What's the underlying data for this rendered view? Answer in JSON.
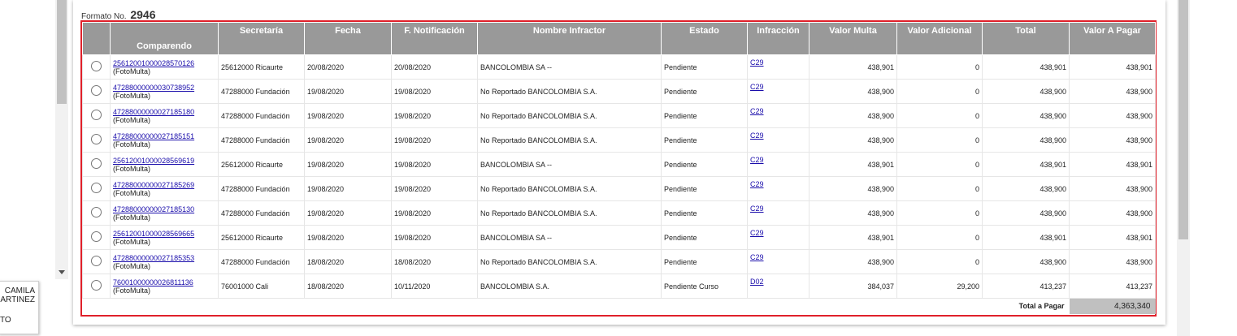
{
  "left_panel": {
    "line1": "CAMILA",
    "line2": "ARTINEZ",
    "line3": "TO"
  },
  "formato": {
    "label": "Formato No.",
    "number": "2946"
  },
  "headers": [
    "",
    "Comparendo",
    "Secretaría",
    "Fecha",
    "F. Notificación",
    "Nombre Infractor",
    "Estado",
    "Infracción",
    "Valor Multa",
    "Valor Adicional",
    "Total",
    "Valor A Pagar"
  ],
  "rows": [
    {
      "comparendo": "25612001000028570126",
      "tipo": "(FotoMulta)",
      "secretaria": "25612000 Ricaurte",
      "fecha": "20/08/2020",
      "notificacion": "20/08/2020",
      "infractor": "BANCOLOMBIA SA --",
      "estado": "Pendiente",
      "infraccion": "C29",
      "valor_multa": "438,901",
      "valor_adicional": "0",
      "total": "438,901",
      "valor_pagar": "438,901"
    },
    {
      "comparendo": "47288000000030738952",
      "tipo": "(FotoMulta)",
      "secretaria": "47288000 Fundación",
      "fecha": "19/08/2020",
      "notificacion": "19/08/2020",
      "infractor": "No Reportado BANCOLOMBIA S.A.",
      "estado": "Pendiente",
      "infraccion": "C29",
      "valor_multa": "438,900",
      "valor_adicional": "0",
      "total": "438,900",
      "valor_pagar": "438,900"
    },
    {
      "comparendo": "47288000000027185180",
      "tipo": "(FotoMulta)",
      "secretaria": "47288000 Fundación",
      "fecha": "19/08/2020",
      "notificacion": "19/08/2020",
      "infractor": "No Reportado BANCOLOMBIA S.A.",
      "estado": "Pendiente",
      "infraccion": "C29",
      "valor_multa": "438,900",
      "valor_adicional": "0",
      "total": "438,900",
      "valor_pagar": "438,900"
    },
    {
      "comparendo": "47288000000027185151",
      "tipo": "(FotoMulta)",
      "secretaria": "47288000 Fundación",
      "fecha": "19/08/2020",
      "notificacion": "19/08/2020",
      "infractor": "No Reportado BANCOLOMBIA S.A.",
      "estado": "Pendiente",
      "infraccion": "C29",
      "valor_multa": "438,900",
      "valor_adicional": "0",
      "total": "438,900",
      "valor_pagar": "438,900"
    },
    {
      "comparendo": "25612001000028569619",
      "tipo": "(FotoMulta)",
      "secretaria": "25612000 Ricaurte",
      "fecha": "19/08/2020",
      "notificacion": "19/08/2020",
      "infractor": "BANCOLOMBIA SA --",
      "estado": "Pendiente",
      "infraccion": "C29",
      "valor_multa": "438,901",
      "valor_adicional": "0",
      "total": "438,901",
      "valor_pagar": "438,901"
    },
    {
      "comparendo": "47288000000027185269",
      "tipo": "(FotoMulta)",
      "secretaria": "47288000 Fundación",
      "fecha": "19/08/2020",
      "notificacion": "19/08/2020",
      "infractor": "No Reportado BANCOLOMBIA S.A.",
      "estado": "Pendiente",
      "infraccion": "C29",
      "valor_multa": "438,900",
      "valor_adicional": "0",
      "total": "438,900",
      "valor_pagar": "438,900"
    },
    {
      "comparendo": "47288000000027185130",
      "tipo": "(FotoMulta)",
      "secretaria": "47288000 Fundación",
      "fecha": "19/08/2020",
      "notificacion": "19/08/2020",
      "infractor": "No Reportado BANCOLOMBIA S.A.",
      "estado": "Pendiente",
      "infraccion": "C29",
      "valor_multa": "438,900",
      "valor_adicional": "0",
      "total": "438,900",
      "valor_pagar": "438,900"
    },
    {
      "comparendo": "25612001000028569665",
      "tipo": "(FotoMulta)",
      "secretaria": "25612000 Ricaurte",
      "fecha": "19/08/2020",
      "notificacion": "19/08/2020",
      "infractor": "BANCOLOMBIA SA --",
      "estado": "Pendiente",
      "infraccion": "C29",
      "valor_multa": "438,901",
      "valor_adicional": "0",
      "total": "438,901",
      "valor_pagar": "438,901"
    },
    {
      "comparendo": "47288000000027185353",
      "tipo": "(FotoMulta)",
      "secretaria": "47288000 Fundación",
      "fecha": "18/08/2020",
      "notificacion": "18/08/2020",
      "infractor": "No Reportado BANCOLOMBIA S.A.",
      "estado": "Pendiente",
      "infraccion": "C29",
      "valor_multa": "438,900",
      "valor_adicional": "0",
      "total": "438,900",
      "valor_pagar": "438,900"
    },
    {
      "comparendo": "76001000000026811136",
      "tipo": "(FotoMulta)",
      "secretaria": "76001000 Cali",
      "fecha": "18/08/2020",
      "notificacion": "10/11/2020",
      "infractor": "BANCOLOMBIA S.A.",
      "estado": "Pendiente Curso",
      "infraccion": "D02",
      "valor_multa": "384,037",
      "valor_adicional": "29,200",
      "total": "413,237",
      "valor_pagar": "413,237"
    }
  ],
  "footer": {
    "total_label": "Total a Pagar",
    "total_value": "4,363,340"
  }
}
